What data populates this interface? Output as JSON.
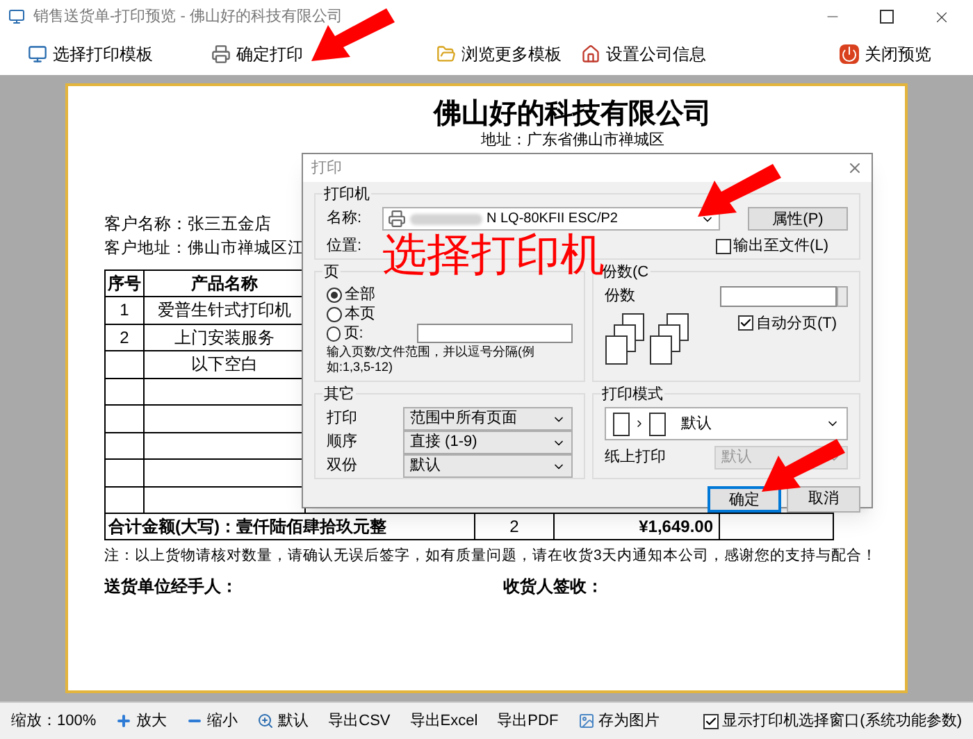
{
  "window": {
    "title": "销售送货单-打印预览 - 佛山好的科技有限公司"
  },
  "toolbar": [
    {
      "label": "选择打印模板",
      "kind": "template"
    },
    {
      "label": "确定打印",
      "kind": "print"
    },
    {
      "label": "浏览更多模板",
      "kind": "browse"
    },
    {
      "label": "设置公司信息",
      "kind": "company"
    },
    {
      "label": "关闭预览",
      "kind": "close"
    }
  ],
  "document": {
    "company": "佛山好的科技有限公司",
    "address": "地址：广东省佛山市禅城区",
    "customer_name": "客户名称：张三五金店",
    "customer_address": "客户地址：佛山市禅城区江",
    "table": {
      "columns": [
        "序号",
        "产品名称"
      ],
      "rows": [
        [
          "1",
          "爱普生针式打印机"
        ],
        [
          "2",
          "上门安装服务"
        ],
        [
          "",
          "以下空白"
        ]
      ],
      "total": {
        "label": "合计金额(大写)：壹仟陆佰肆拾玖元整",
        "quantity": "2",
        "amount": "¥1,649.00"
      }
    },
    "note": "注：以上货物请核对数量，请确认无误后签字，如有质量问题，请在收货3天内通知本公司，感谢您的支持与配合！",
    "signatures": [
      "送货单位经手人：",
      "收货人签收："
    ]
  },
  "dialog": {
    "title": "打印",
    "printer": {
      "group": "打印机",
      "name_label": "名称:",
      "name_value": "N LQ-80KFII ESC/P2",
      "properties": "属性(P)",
      "location_label": "位置:",
      "to_file": {
        "label": "输出至文件(L)",
        "checked": false
      }
    },
    "pages": {
      "group": "页",
      "options": [
        {
          "label": "全部",
          "selected": true
        },
        {
          "label": "本页",
          "selected": false
        },
        {
          "label": "页:",
          "selected": false
        }
      ],
      "hint": "输入页数/文件范围，并以逗号分隔(例如:1,3,5-12)"
    },
    "copies": {
      "group": "份数(C",
      "label": "份数",
      "collate": {
        "label": "自动分页(T)",
        "checked": true
      }
    },
    "other": {
      "group": "其它",
      "rows": [
        {
          "label": "打印",
          "value": "范围中所有页面"
        },
        {
          "label": "顺序",
          "value": "直接 (1-9)"
        },
        {
          "label": "双份",
          "value": "默认"
        }
      ]
    },
    "mode": {
      "group": "打印模式",
      "value": "默认",
      "paper": {
        "label": "纸上打印",
        "value": "默认",
        "disabled": true
      }
    },
    "buttons": [
      {
        "label": "确定",
        "default": true
      },
      {
        "label": "取消",
        "default": false
      }
    ]
  },
  "annotation": {
    "text": "选择打印机"
  },
  "status_bar": {
    "zoom": "缩放：100%",
    "buttons": [
      {
        "label": "放大",
        "kind": "plus"
      },
      {
        "label": "缩小",
        "kind": "minus"
      },
      {
        "label": "默认",
        "kind": "fit"
      },
      {
        "label": "导出CSV",
        "kind": "text"
      },
      {
        "label": "导出Excel",
        "kind": "text"
      },
      {
        "label": "导出PDF",
        "kind": "text"
      },
      {
        "label": "存为图片",
        "kind": "image"
      }
    ],
    "option": {
      "label": "显示打印机选择窗口(系统功能参数)",
      "checked": true
    }
  }
}
